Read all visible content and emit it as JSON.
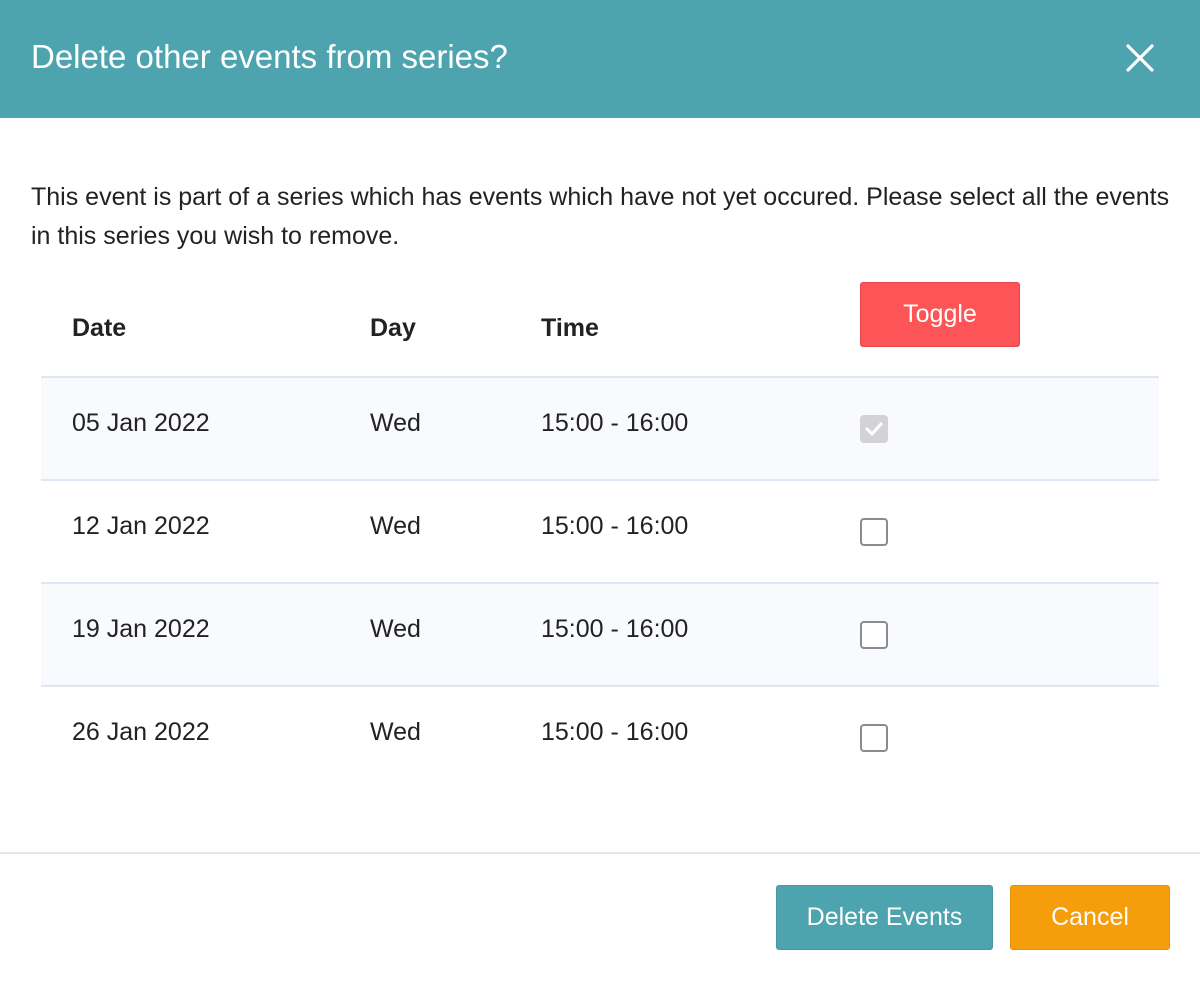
{
  "dialog": {
    "title": "Delete other events from series?",
    "description": "This event is part of a series which has events which have not yet occured. Please select all the events in this series you wish to remove."
  },
  "table": {
    "headers": {
      "date": "Date",
      "day": "Day",
      "time": "Time"
    },
    "toggle_label": "Toggle",
    "rows": [
      {
        "date": "05 Jan 2022",
        "day": "Wed",
        "time": "15:00 - 16:00",
        "checked": true,
        "disabled": true
      },
      {
        "date": "12 Jan 2022",
        "day": "Wed",
        "time": "15:00 - 16:00",
        "checked": false,
        "disabled": false
      },
      {
        "date": "19 Jan 2022",
        "day": "Wed",
        "time": "15:00 - 16:00",
        "checked": false,
        "disabled": false
      },
      {
        "date": "26 Jan 2022",
        "day": "Wed",
        "time": "15:00 - 16:00",
        "checked": false,
        "disabled": false
      }
    ]
  },
  "footer": {
    "delete_label": "Delete Events",
    "cancel_label": "Cancel"
  },
  "colors": {
    "header": "#4ea4ae",
    "toggle": "#fc5457",
    "delete": "#4ea4ae",
    "cancel": "#f59d0a"
  },
  "icons": {
    "close": "close-icon",
    "check": "check-icon"
  }
}
